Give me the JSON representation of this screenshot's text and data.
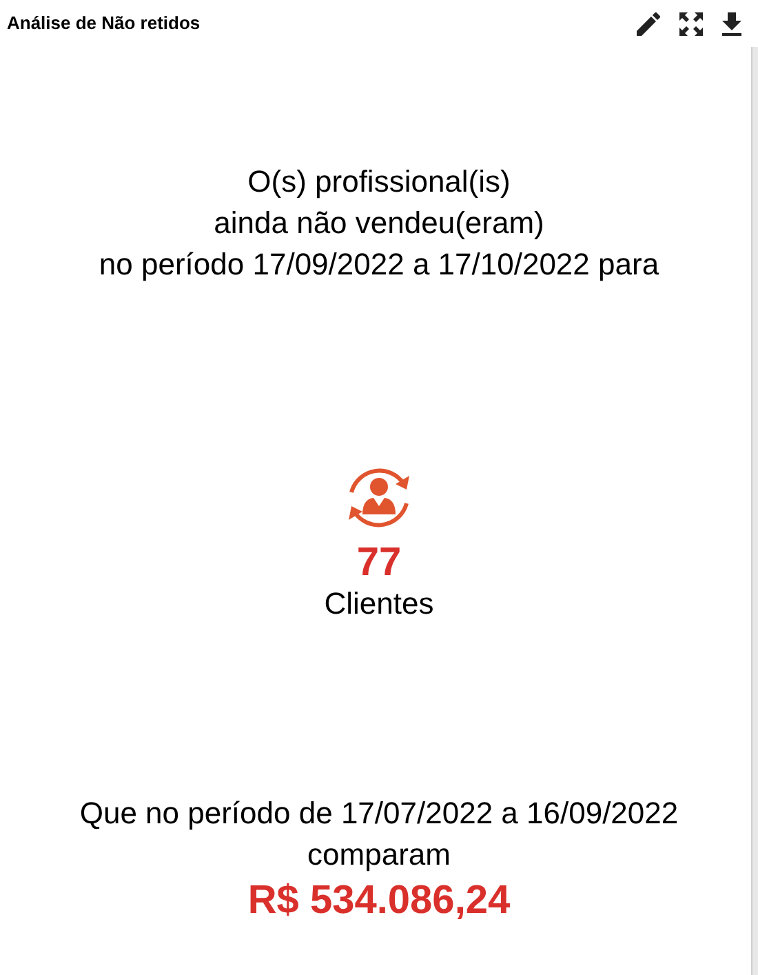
{
  "panel": {
    "title": "Análise de Não retidos"
  },
  "intro_lines": [
    "O(s) profissional(is)",
    "ainda não vendeu(eram)",
    "no período 17/09/2022 a 17/10/2022 para"
  ],
  "metric": {
    "value": "77",
    "label": "Clientes"
  },
  "comparison": {
    "lines": [
      "Que no período de 17/07/2022 a 16/09/2022",
      "comparam"
    ],
    "amount": "R$ 534.086,24"
  }
}
